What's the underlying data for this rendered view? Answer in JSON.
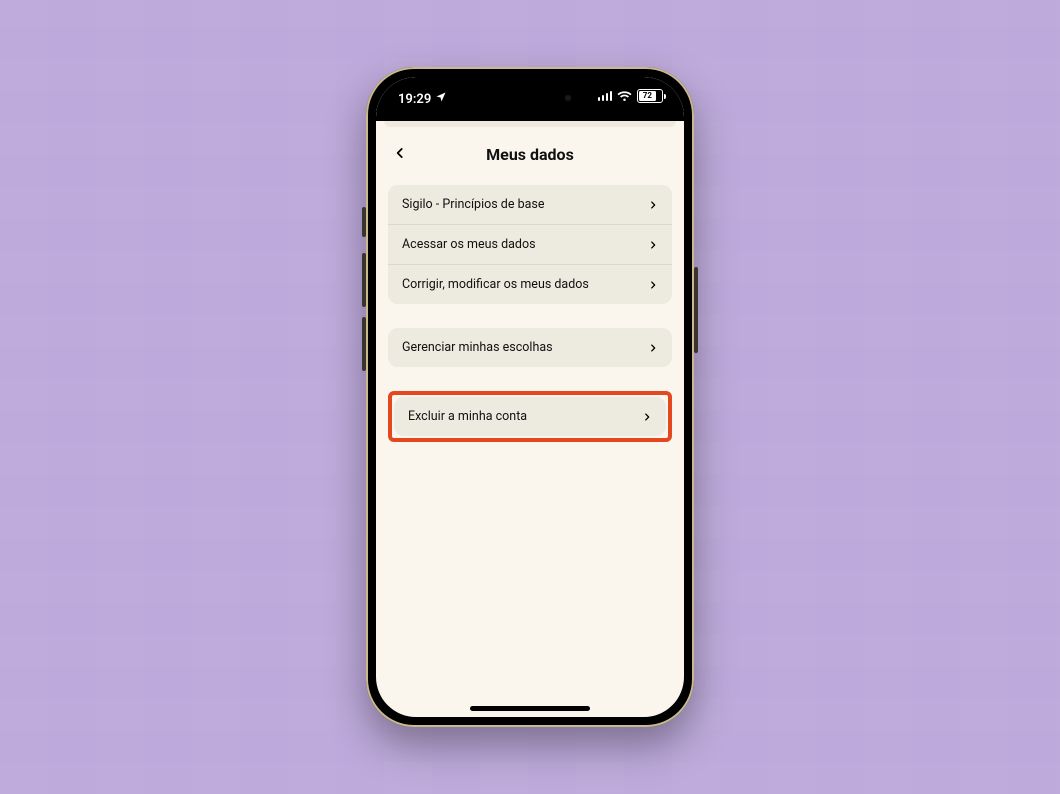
{
  "status": {
    "time": "19:29",
    "battery_pct": "72"
  },
  "page": {
    "title": "Meus dados"
  },
  "groups": [
    {
      "highlighted": false,
      "rows": [
        {
          "label": "Sigilo - Princípios de base",
          "name": "privacy-principles-row"
        },
        {
          "label": "Acessar os meus dados",
          "name": "access-my-data-row"
        },
        {
          "label": "Corrigir, modificar os meus dados",
          "name": "correct-my-data-row"
        }
      ]
    },
    {
      "highlighted": false,
      "rows": [
        {
          "label": "Gerenciar minhas escolhas",
          "name": "manage-choices-row"
        }
      ]
    },
    {
      "highlighted": true,
      "rows": [
        {
          "label": "Excluir a minha conta",
          "name": "delete-account-row"
        }
      ]
    }
  ]
}
